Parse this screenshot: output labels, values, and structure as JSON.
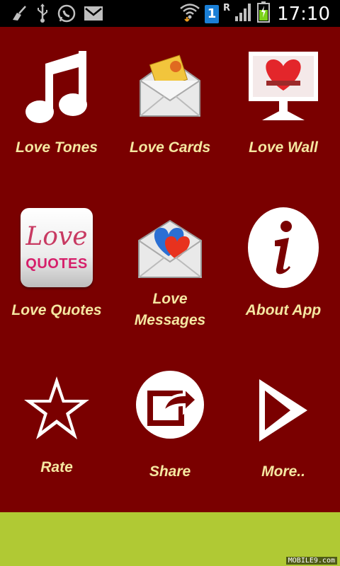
{
  "status_bar": {
    "time": "17:10",
    "sim_slot": "1",
    "roaming": "R",
    "icons": [
      "cleanup-icon",
      "usb-icon",
      "whatsapp-icon",
      "email-icon",
      "wifi-icon",
      "signal-icon",
      "battery-icon"
    ],
    "colors": {
      "background": "#000000",
      "icon": "#bfbfbf",
      "battery_fill": "#7bd21a",
      "sim": "#1a7fd6"
    }
  },
  "menu": {
    "love_tones": "Love Tones",
    "love_cards": "Love Cards",
    "love_wall": "Love Wall",
    "love_quotes": "Love Quotes",
    "love_messages_line1": "Love",
    "love_messages_line2": "Messages",
    "about_app": "About App",
    "rate": "Rate",
    "share": "Share",
    "more": "More.."
  },
  "quotes_icon": {
    "line1": "Love",
    "line2": "QUOTES"
  },
  "ad_banner": {
    "watermark": "MOBILE9.com"
  },
  "colors": {
    "background": "#7a0000",
    "label": "#f5e7a1",
    "ad_bar": "#b0c934"
  }
}
